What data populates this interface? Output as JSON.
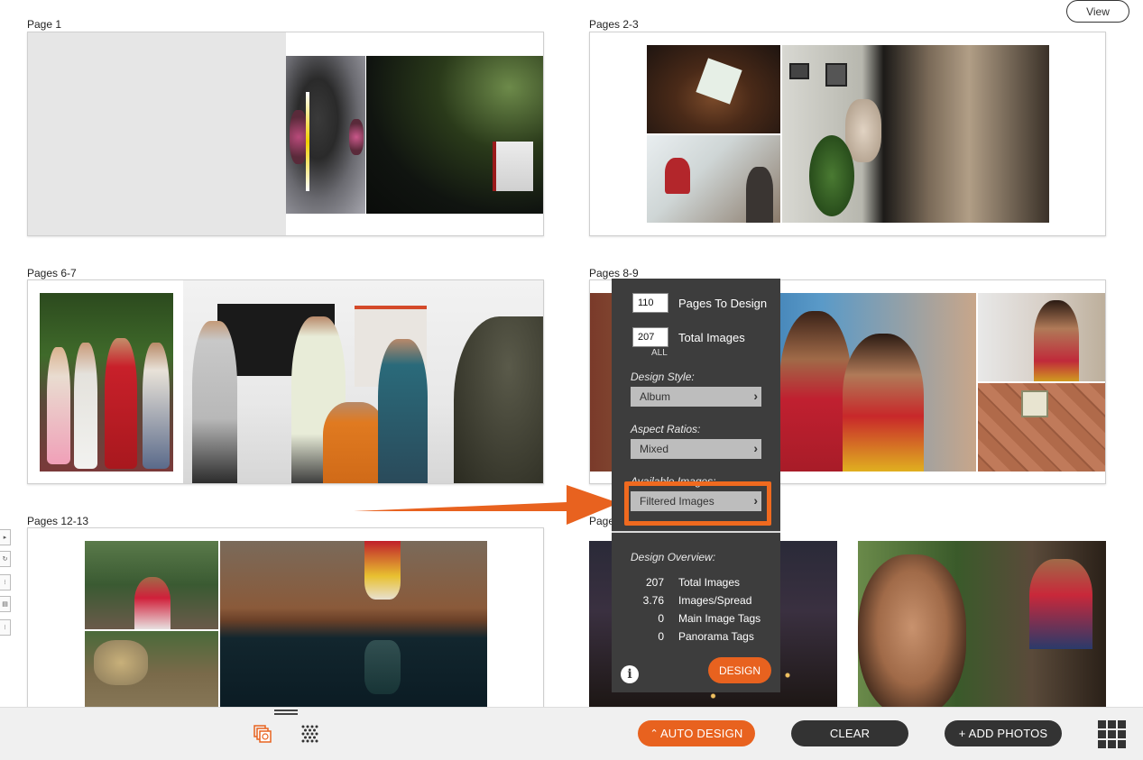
{
  "header": {
    "view_label": "View"
  },
  "spreads": [
    {
      "label": "Page 1"
    },
    {
      "label": "Pages 2-3"
    },
    {
      "label": "Pages 6-7"
    },
    {
      "label": "Pages 8-9"
    },
    {
      "label": "Pages 12-13"
    },
    {
      "label": "Page"
    }
  ],
  "design_panel": {
    "pages_to_design_value": "110",
    "pages_to_design_label": "Pages To Design",
    "total_images_value": "207",
    "total_images_label": "Total Images",
    "all_label": "ALL",
    "design_style_heading": "Design Style:",
    "design_style_value": "Album",
    "aspect_ratios_heading": "Aspect Ratios:",
    "aspect_ratios_value": "Mixed",
    "available_images_heading": "Available Images:",
    "available_images_value": "Filtered Images",
    "overview_heading": "Design Overview:",
    "overview": [
      {
        "value": "207",
        "label": "Total Images"
      },
      {
        "value": "3.76",
        "label": "Images/Spread"
      },
      {
        "value": "0",
        "label": "Main Image Tags"
      },
      {
        "value": "0",
        "label": "Panorama Tags"
      }
    ],
    "design_button": "DESIGN"
  },
  "bottom_bar": {
    "auto_design": "AUTO DESIGN",
    "clear": "CLEAR",
    "add_photos": "+ ADD PHOTOS"
  },
  "colors": {
    "accent": "#e8621f",
    "panel_bg": "#3d3d3d",
    "pill_dark": "#333333"
  },
  "icons": [
    "spreads-view-icon",
    "grid-pattern-icon",
    "grid-menu-icon",
    "info-icon",
    "chevron-right-icon",
    "orange-arrow"
  ]
}
